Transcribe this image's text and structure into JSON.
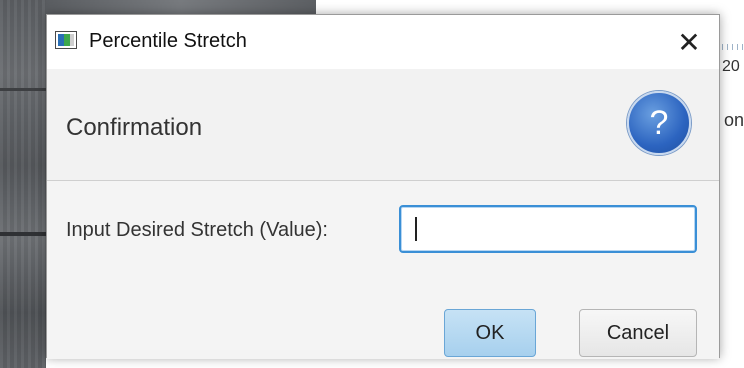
{
  "background": {
    "right_text_1": "20",
    "right_text_2": "on"
  },
  "dialog": {
    "window_title": "Percentile Stretch",
    "close_glyph": "✕",
    "header_text": "Confirmation",
    "help_glyph": "?",
    "field_label": "Input Desired Stretch (Value):",
    "field_value": "",
    "ok_label": "OK",
    "cancel_label": "Cancel"
  },
  "icons": {
    "app": "app-icon",
    "help": "question-mark-icon",
    "close": "close-icon"
  },
  "colors": {
    "help_icon": "#2c64c0",
    "focus_border": "#3a8fd6",
    "ok_button": "#a7d0ee"
  }
}
